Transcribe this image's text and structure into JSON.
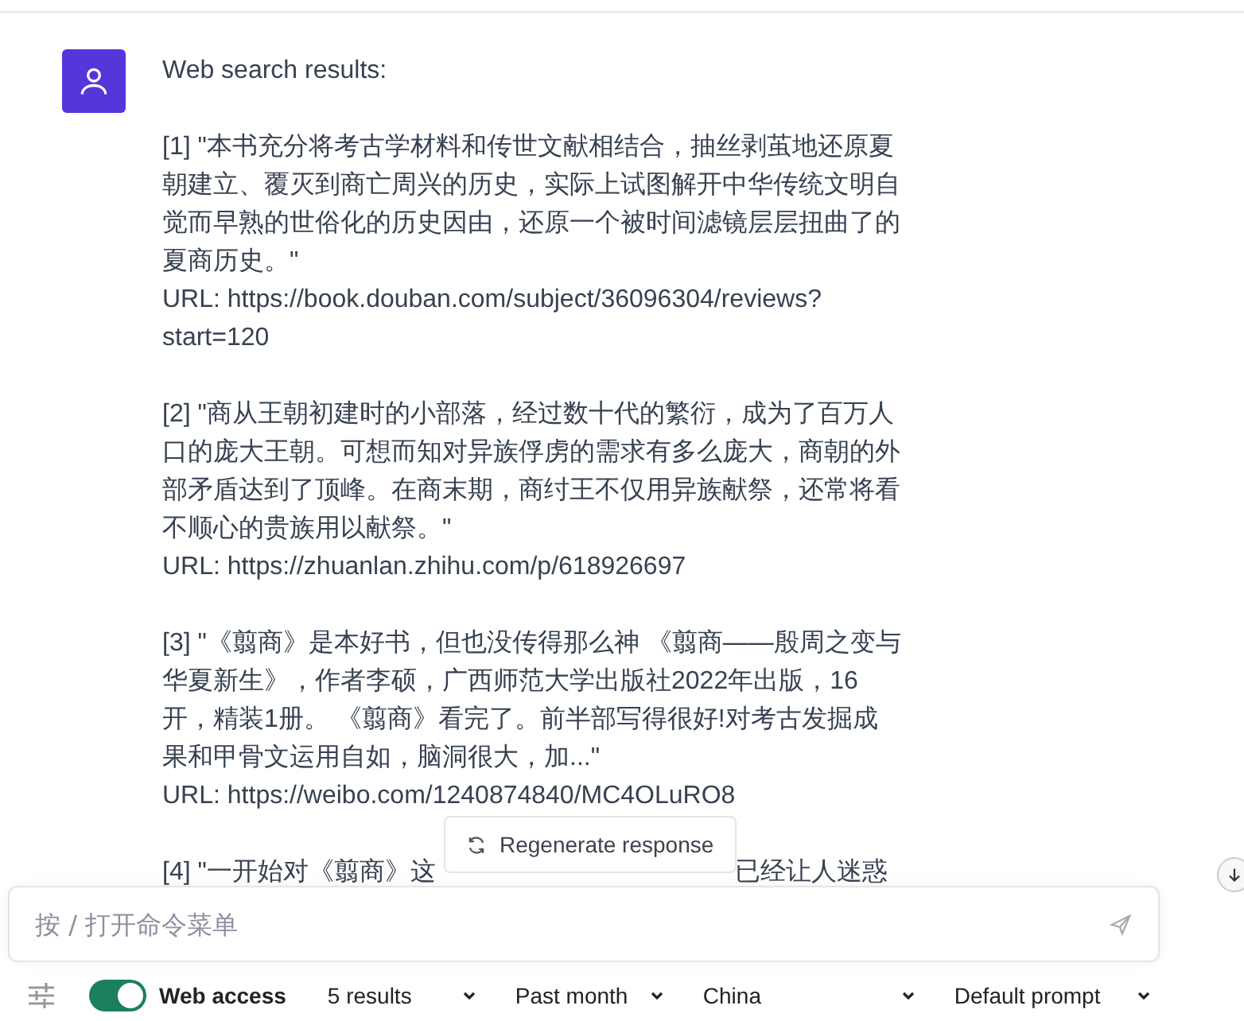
{
  "message": {
    "heading": "Web search results:",
    "results": [
      {
        "quote": "[1] \"本书充分将考古学材料和传世文献相结合，抽丝剥茧地还原夏朝建立、覆灭到商亡周兴的历史，实际上试图解开中华传统文明自觉而早熟的世俗化的历史因由，还原一个被时间滤镜层层扭曲了的夏商历史。\"",
        "url": "URL: https://book.douban.com/subject/36096304/reviews?start=120"
      },
      {
        "quote": "[2] \"商从王朝初建时的小部落，经过数十代的繁衍，成为了百万人口的庞大王朝。可想而知对异族俘虏的需求有多么庞大，商朝的外部矛盾达到了顶峰。在商末期，商纣王不仅用异族献祭，还常将看不顺心的贵族用以献祭。\"",
        "url": "URL: https://zhuanlan.zhihu.com/p/618926697"
      },
      {
        "quote": "[3] \"《翦商》是本好书，但也没传得那么神 《翦商——殷周之变与华夏新生》，作者李硕，广西师范大学出版社2022年出版，16开，精装1册。 《翦商》看完了。前半部写得很好!对考古发掘成果和甲骨文运用自如，脑洞很大，加...\"",
        "url": "URL: https://weibo.com/1240874840/MC4OLuRO8"
      },
      {
        "quote": "[4] \"一开始对《翦商》这",
        "quote_after_cover": "已经让人迷惑"
      }
    ]
  },
  "regenerate": {
    "label": "Regenerate response"
  },
  "input": {
    "placeholder": "按 / 打开命令菜单"
  },
  "toolbar": {
    "web_access": {
      "label": "Web access",
      "on": true
    },
    "selects": [
      {
        "value": "5 results"
      },
      {
        "value": "Past month"
      },
      {
        "value": "China"
      },
      {
        "value": "Default prompt"
      }
    ]
  }
}
